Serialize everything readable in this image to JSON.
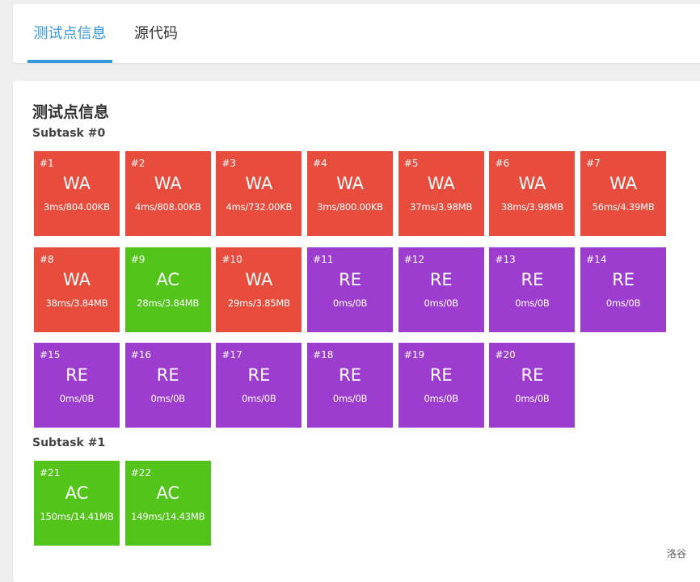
{
  "tabs": [
    {
      "label": "测试点信息",
      "active": true
    },
    {
      "label": "源代码",
      "active": false
    }
  ],
  "section_title": "测试点信息",
  "subtasks": [
    {
      "title": "Subtask #0",
      "cases": [
        {
          "id": "#1",
          "status": "WA",
          "info": "3ms/804.00KB"
        },
        {
          "id": "#2",
          "status": "WA",
          "info": "4ms/808.00KB"
        },
        {
          "id": "#3",
          "status": "WA",
          "info": "4ms/732.00KB"
        },
        {
          "id": "#4",
          "status": "WA",
          "info": "3ms/800.00KB"
        },
        {
          "id": "#5",
          "status": "WA",
          "info": "37ms/3.98MB"
        },
        {
          "id": "#6",
          "status": "WA",
          "info": "38ms/3.98MB"
        },
        {
          "id": "#7",
          "status": "WA",
          "info": "56ms/4.39MB"
        },
        {
          "id": "#8",
          "status": "WA",
          "info": "38ms/3.84MB"
        },
        {
          "id": "#9",
          "status": "AC",
          "info": "28ms/3.84MB"
        },
        {
          "id": "#10",
          "status": "WA",
          "info": "29ms/3.85MB"
        },
        {
          "id": "#11",
          "status": "RE",
          "info": "0ms/0B"
        },
        {
          "id": "#12",
          "status": "RE",
          "info": "0ms/0B"
        },
        {
          "id": "#13",
          "status": "RE",
          "info": "0ms/0B"
        },
        {
          "id": "#14",
          "status": "RE",
          "info": "0ms/0B"
        },
        {
          "id": "#15",
          "status": "RE",
          "info": "0ms/0B"
        },
        {
          "id": "#16",
          "status": "RE",
          "info": "0ms/0B"
        },
        {
          "id": "#17",
          "status": "RE",
          "info": "0ms/0B"
        },
        {
          "id": "#18",
          "status": "RE",
          "info": "0ms/0B"
        },
        {
          "id": "#19",
          "status": "RE",
          "info": "0ms/0B"
        },
        {
          "id": "#20",
          "status": "RE",
          "info": "0ms/0B"
        }
      ]
    },
    {
      "title": "Subtask #1",
      "cases": [
        {
          "id": "#21",
          "status": "AC",
          "info": "150ms/14.41MB"
        },
        {
          "id": "#22",
          "status": "AC",
          "info": "149ms/14.43MB"
        }
      ]
    }
  ],
  "status_colors": {
    "WA": "#e74c3c",
    "AC": "#52c41a",
    "RE": "#9d3dcf"
  },
  "accent_color": "#3498db",
  "footer_brand": "洛谷"
}
